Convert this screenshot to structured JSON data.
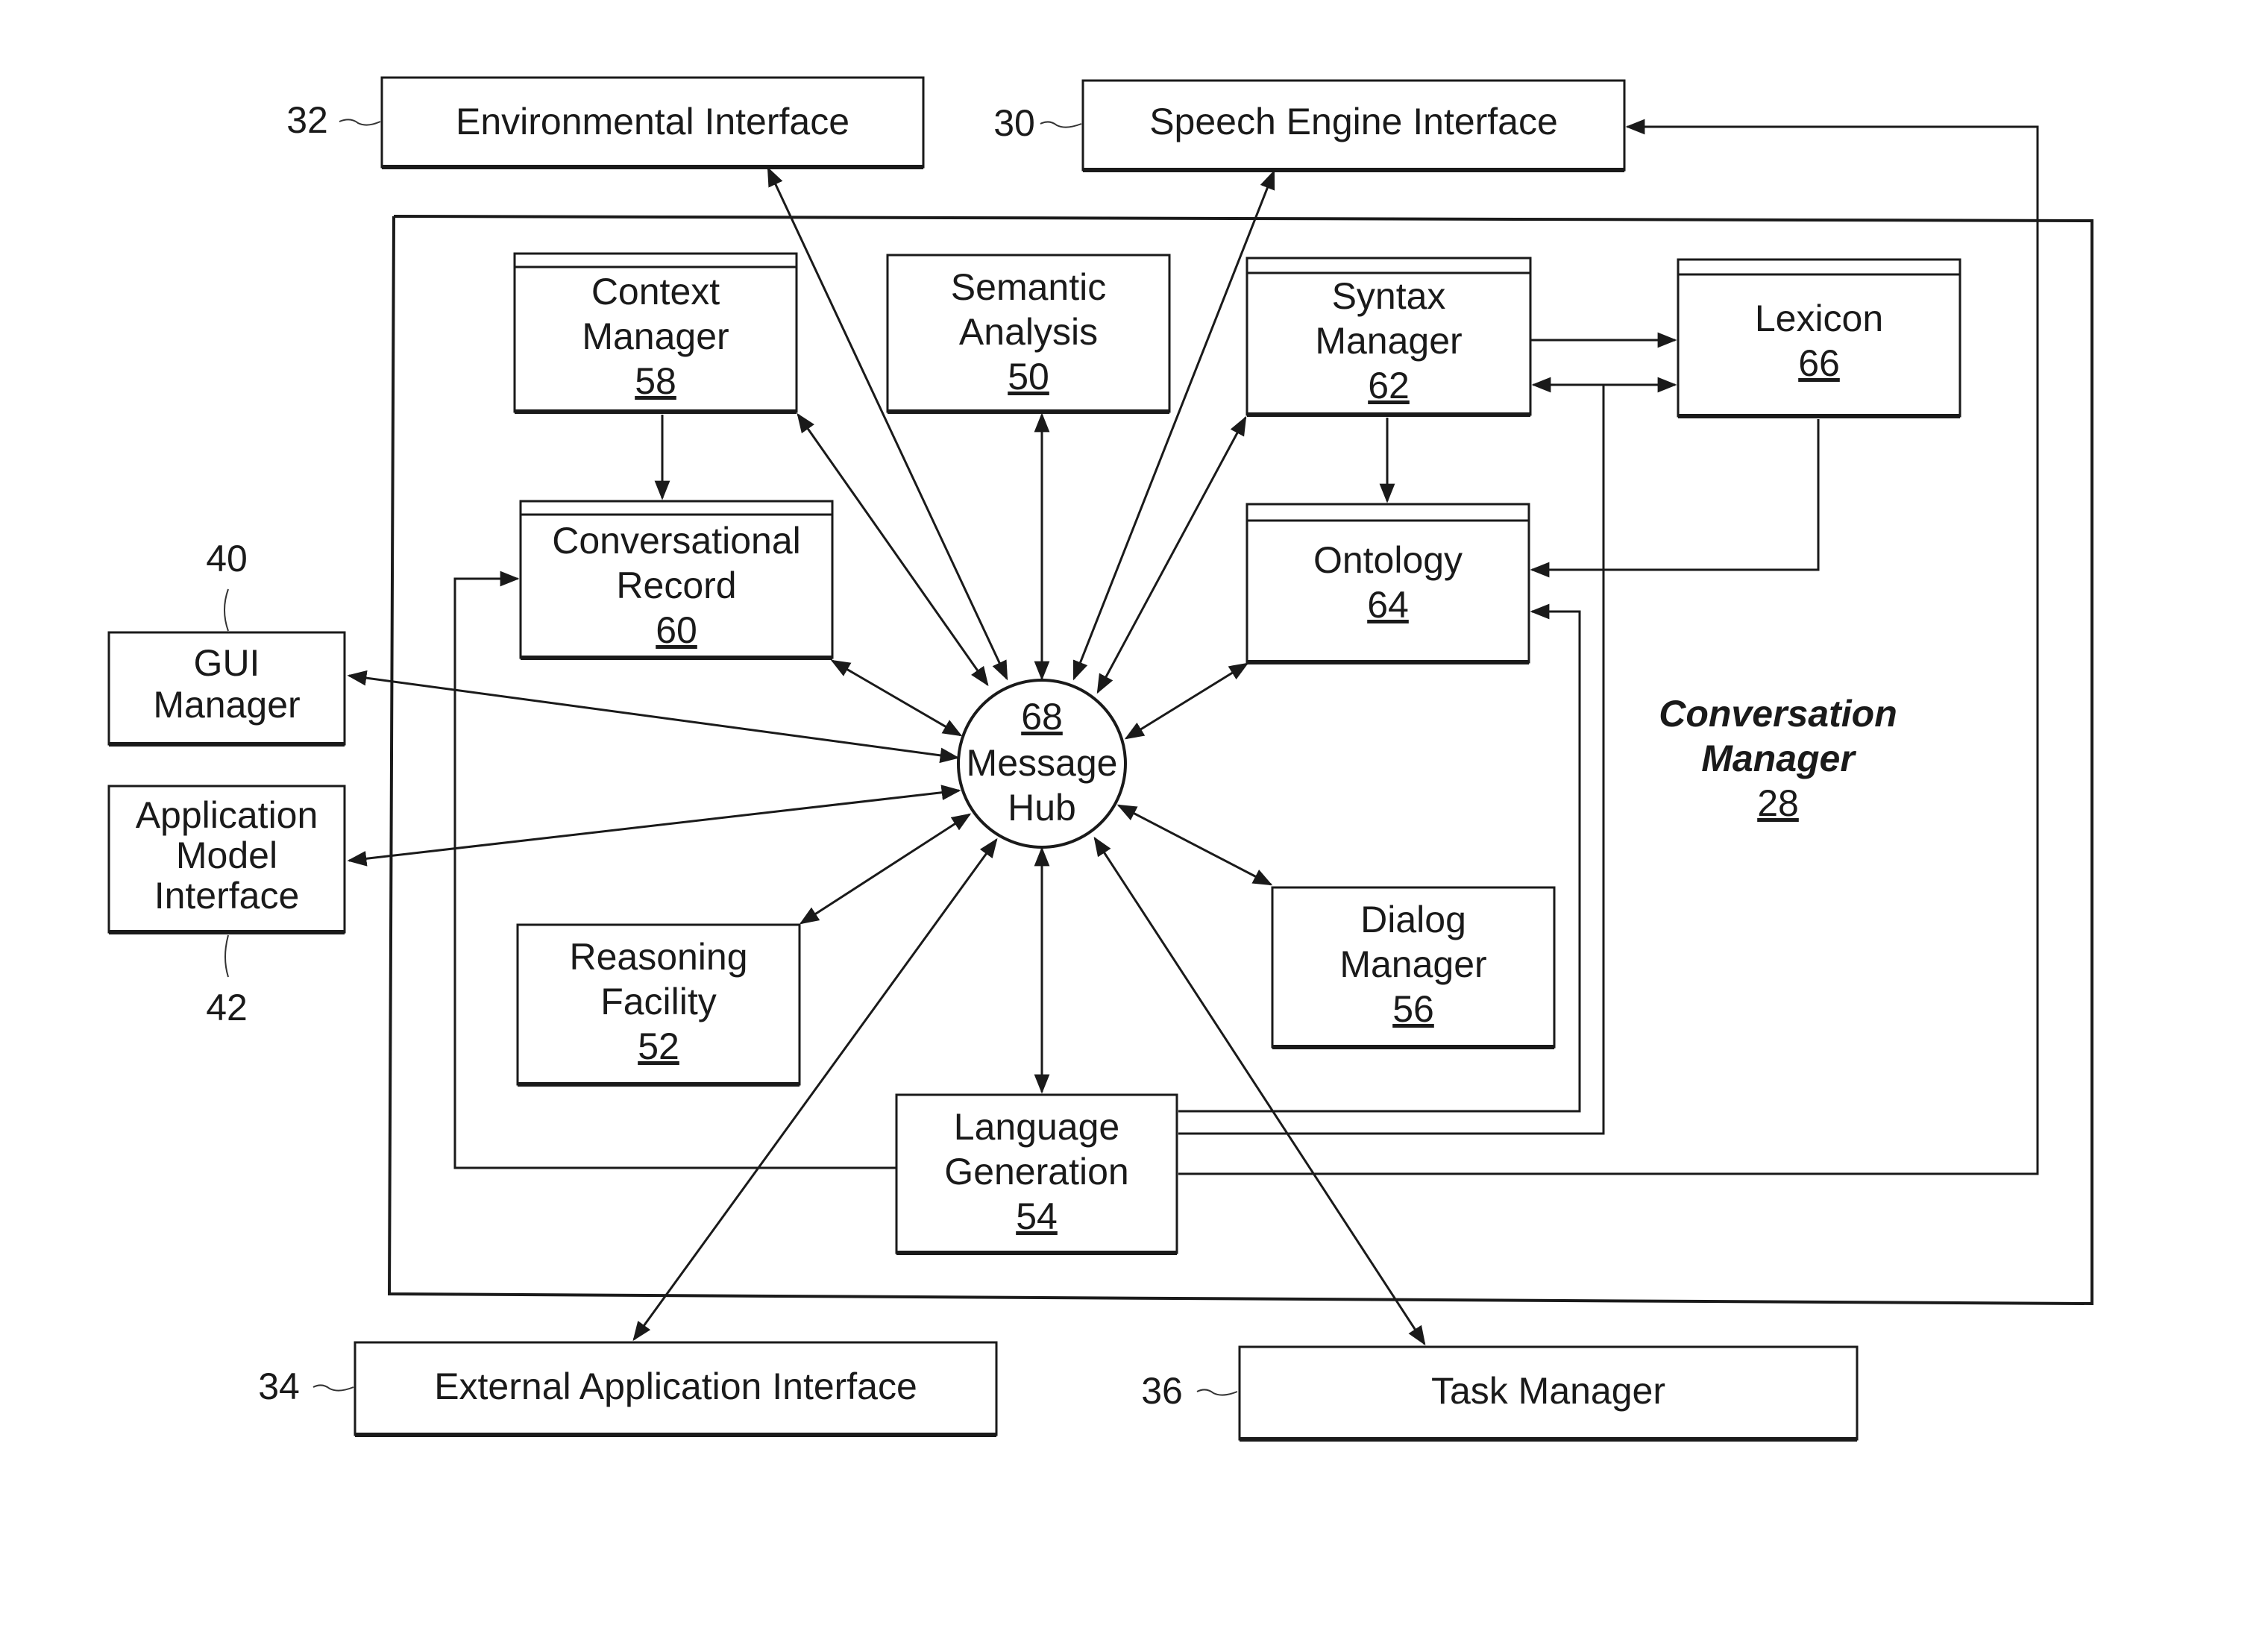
{
  "diagram": {
    "container": {
      "title_line1": "Conversation",
      "title_line2": "Manager",
      "ref": "28"
    },
    "hub": {
      "ref": "68",
      "line1": "Message",
      "line2": "Hub"
    },
    "external": {
      "environmental": {
        "label": "Environmental Interface",
        "callout": "32"
      },
      "speech": {
        "label": "Speech Engine Interface",
        "callout": "30"
      },
      "external_app": {
        "label": "External Application Interface",
        "callout": "34"
      },
      "task": {
        "label": "Task Manager",
        "callout": "36"
      },
      "gui": {
        "line1": "GUI",
        "line2": "Manager",
        "callout": "40"
      },
      "app_model": {
        "line1": "Application",
        "line2": "Model",
        "line3": "Interface",
        "callout": "42"
      }
    },
    "modules": {
      "context": {
        "line1": "Context",
        "line2": "Manager",
        "ref": "58"
      },
      "semantic": {
        "line1": "Semantic",
        "line2": "Analysis",
        "ref": "50"
      },
      "syntax": {
        "line1": "Syntax",
        "line2": "Manager",
        "ref": "62"
      },
      "lexicon": {
        "line1": "Lexicon",
        "ref": "66"
      },
      "conversational": {
        "line1": "Conversational",
        "line2": "Record",
        "ref": "60"
      },
      "ontology": {
        "line1": "Ontology",
        "ref": "64"
      },
      "reasoning": {
        "line1": "Reasoning",
        "line2": "Facility",
        "ref": "52"
      },
      "dialog": {
        "line1": "Dialog",
        "line2": "Manager",
        "ref": "56"
      },
      "language": {
        "line1": "Language",
        "line2": "Generation",
        "ref": "54"
      }
    },
    "colors": {
      "ink": "#1a1a1a",
      "background": "#ffffff"
    }
  }
}
